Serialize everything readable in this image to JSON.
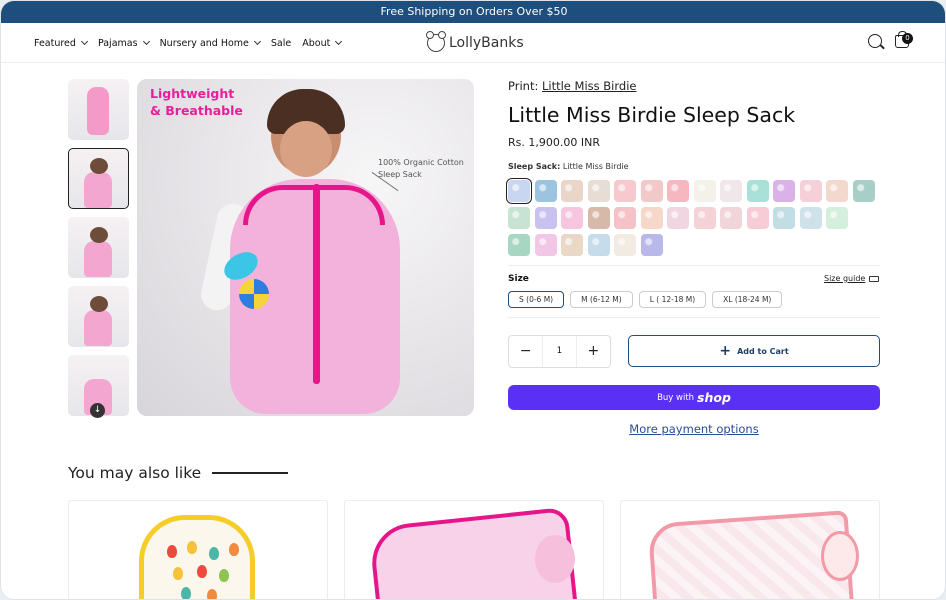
{
  "announcement": "Free Shipping on Orders Over $50",
  "nav": {
    "items": [
      {
        "label": "Featured",
        "dropdown": true
      },
      {
        "label": "Pajamas",
        "dropdown": true
      },
      {
        "label": "Nursery and Home",
        "dropdown": true
      },
      {
        "label": "Sale",
        "dropdown": false
      },
      {
        "label": "About",
        "dropdown": true
      }
    ],
    "logo_text": "LollyBanks",
    "cart_count": "0"
  },
  "product": {
    "print_label": "Print:",
    "print_value": "Little Miss Birdie",
    "title": "Little Miss Birdie Sleep Sack",
    "price": "Rs. 1,900.00 INR",
    "variant_label": "Sleep Sack:",
    "variant_value": "Little Miss Birdie",
    "image_overlay_title": "Lightweight\n& Breathable",
    "image_overlay_note": "100% Organic Cotton\nSleep Sack"
  },
  "swatch_colors": [
    "#c9d6f2",
    "#9cc3e0",
    "#e9d6c8",
    "#e8ddd5",
    "#f7c9cf",
    "#f2c9c9",
    "#f7b7c0",
    "#f4f1ea",
    "#f1e6e9",
    "#a9e0d8",
    "#d9b3e8",
    "#f6d0d8",
    "#f3d9cd",
    "#a8cfc7",
    "#c8e3d1",
    "#c9c2f0",
    "#f6c6de",
    "#d6b9a9",
    "#f5c2c8",
    "#f7d7c9",
    "#efd6e1",
    "#f5d2d8",
    "#f2d4db",
    "#f7ccd6",
    "#c3dde5",
    "#cfe2ea",
    "#d4efdc",
    "#a7d7c3",
    "#f2c6e6",
    "#ead8c7",
    "#c6dcea",
    "#f1ebe1",
    "#b9b8ea"
  ],
  "size": {
    "label": "Size",
    "guide_label": "Size guide",
    "options": [
      "S (0-6 M)",
      "M (6-12 M)",
      "L ( 12-18 M)",
      "XL (18-24 M)"
    ],
    "selected": "S (0-6 M)"
  },
  "quantity": {
    "minus": "−",
    "value": "1",
    "plus": "+"
  },
  "buttons": {
    "add_to_cart": "Add to Cart",
    "buy_with": "Buy with",
    "shop": "shop",
    "more_payment": "More payment options"
  },
  "recommendations": {
    "title": "You may also like"
  }
}
